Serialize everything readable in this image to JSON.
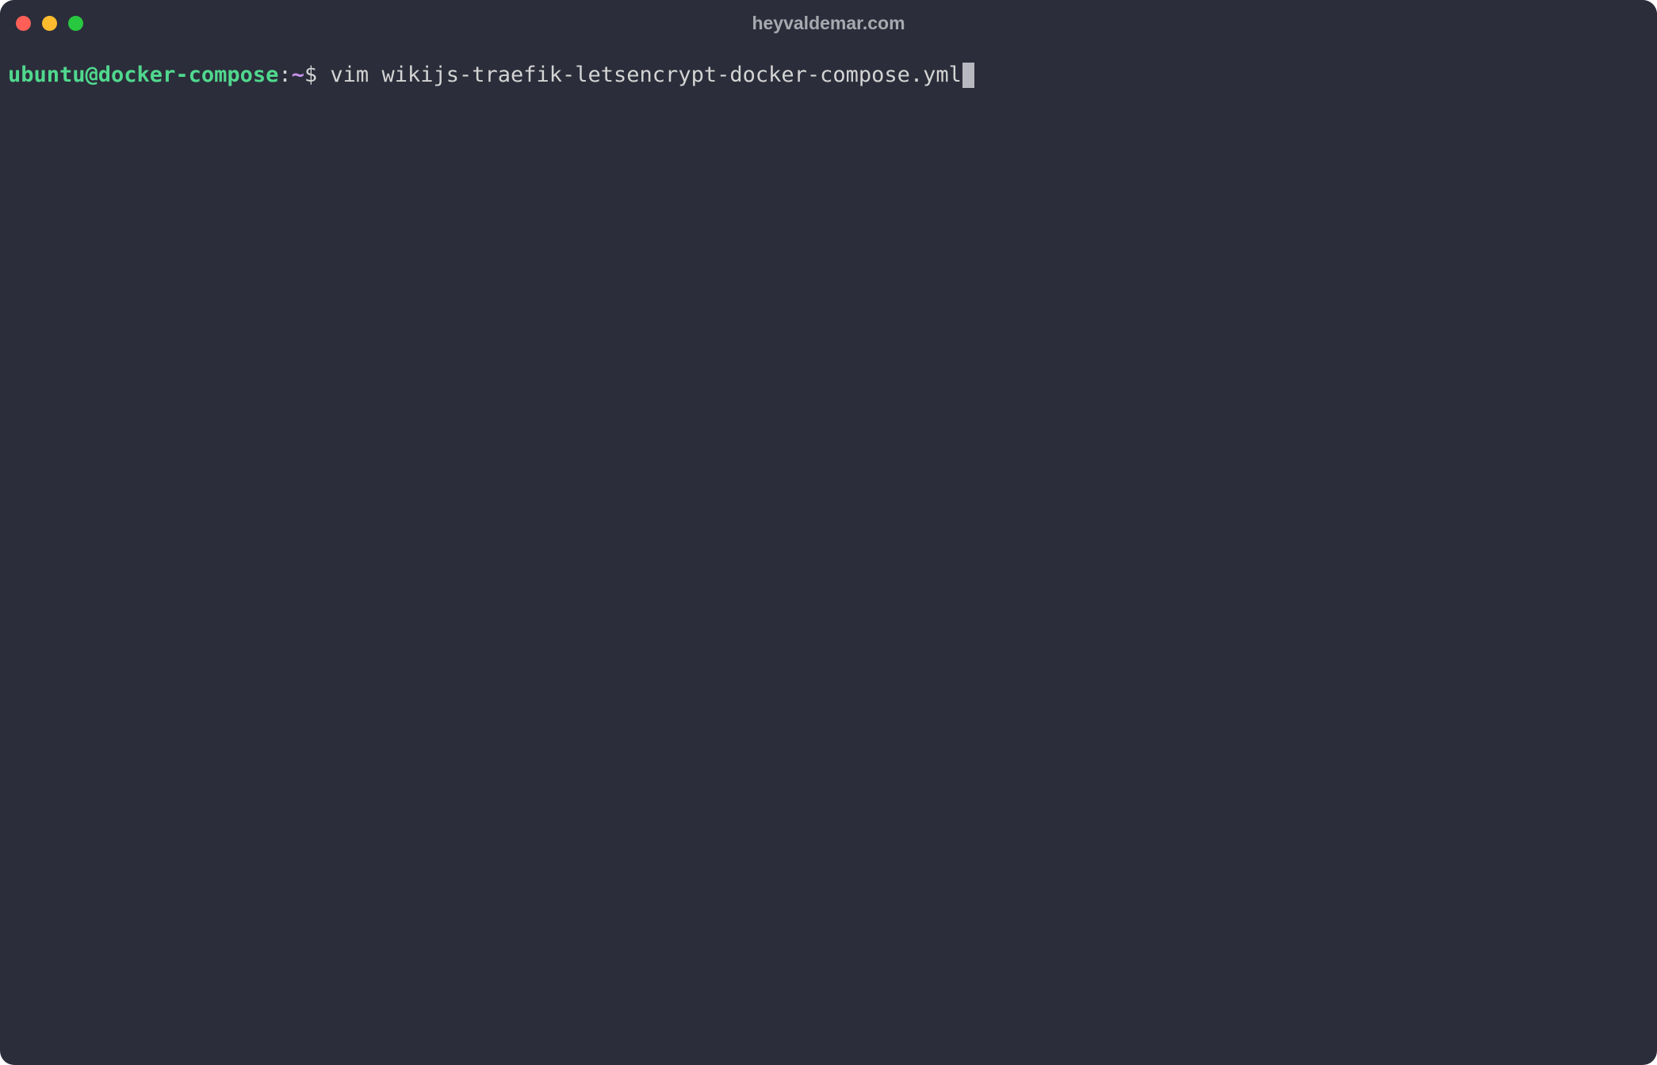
{
  "window": {
    "title": "heyvaldemar.com"
  },
  "prompt": {
    "user_host": "ubuntu@docker-compose",
    "colon": ":",
    "path": "~",
    "dollar": "$ "
  },
  "command": "vim wikijs-traefik-letsencrypt-docker-compose.yml",
  "colors": {
    "background": "#2b2d3a",
    "prompt_green": "#50d88e",
    "prompt_purple": "#c792ea",
    "text": "#d4d4d4",
    "close": "#ff5f57",
    "minimize": "#febc2e",
    "maximize": "#28c840"
  }
}
